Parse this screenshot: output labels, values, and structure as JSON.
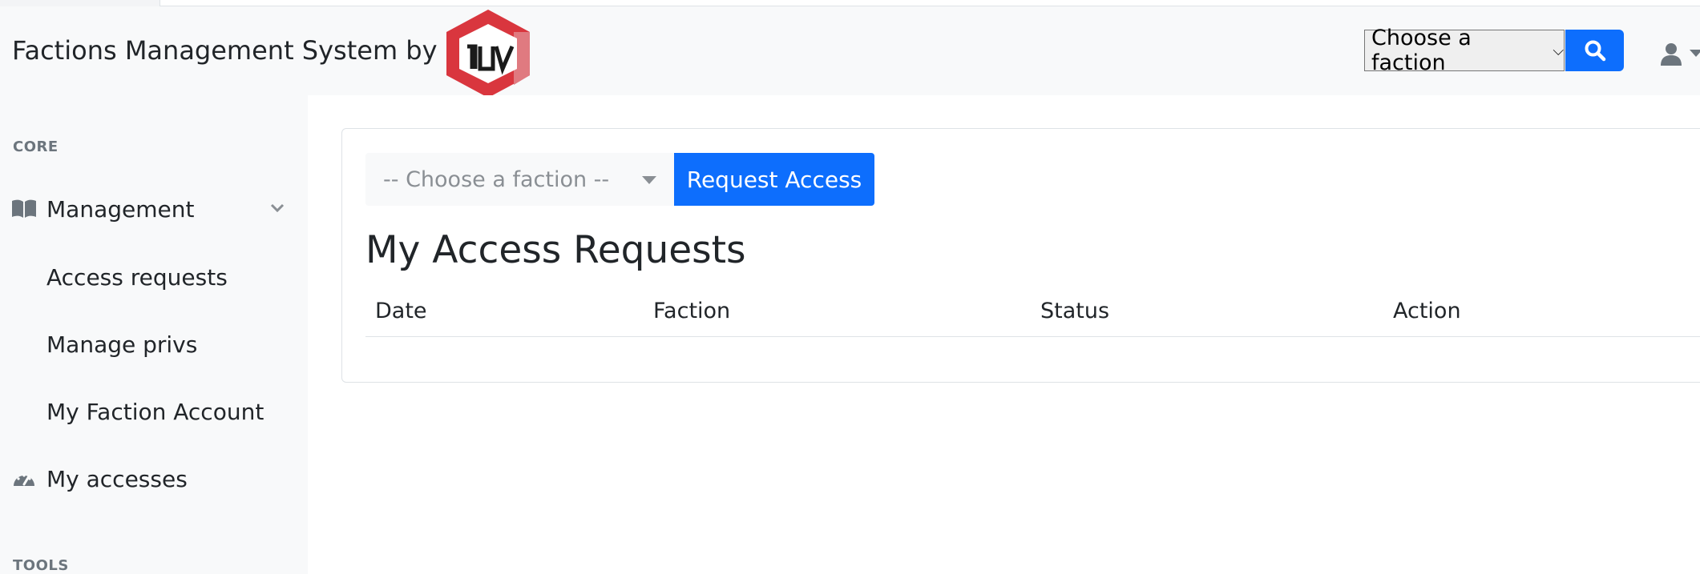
{
  "navbar": {
    "brand": "Factions Management System by",
    "faction_select": {
      "value": "Choose a faction"
    },
    "logo_name": "rdv-logo",
    "colors": {
      "primary": "#0d6efd",
      "logo": "#d9363e"
    }
  },
  "sidebar": {
    "section_core": "CORE",
    "section_tools": "TOOLS",
    "items": [
      {
        "label": "Management",
        "icon": "book-open-icon",
        "expanded": true
      },
      {
        "label": "Access requests"
      },
      {
        "label": "Manage privs"
      },
      {
        "label": "My Faction Account"
      },
      {
        "label": "My accesses",
        "icon": "tachometer-icon"
      }
    ]
  },
  "main": {
    "select_placeholder": "-- Choose a faction --",
    "request_button": "Request Access",
    "title": "My Access Requests",
    "table": {
      "headers": [
        "Date",
        "Faction",
        "Status",
        "Action"
      ],
      "rows": []
    }
  }
}
